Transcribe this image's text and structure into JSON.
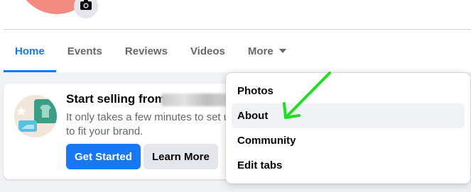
{
  "colors": {
    "accent": "#1877f2",
    "avatar": "#f28b82",
    "annotation_arrow": "#22dd22",
    "page_bg": "#f0f2f5"
  },
  "profile": {
    "avatar_icon": "avatar-image",
    "camera_icon": "camera-icon"
  },
  "tabs": [
    {
      "label": "Home",
      "active": true
    },
    {
      "label": "Events",
      "active": false
    },
    {
      "label": "Reviews",
      "active": false
    },
    {
      "label": "Videos",
      "active": false
    },
    {
      "label": "More",
      "active": false,
      "icon": "caret-down-icon"
    }
  ],
  "card": {
    "title": "Start selling from",
    "description_lines": [
      "It only takes a few minutes to set u",
      "to fit your brand."
    ],
    "primary_button": "Get Started",
    "secondary_button": "Learn More",
    "illustration_icon": "shop-illustration"
  },
  "more_menu": {
    "items": [
      {
        "label": "Photos",
        "highlighted": false
      },
      {
        "label": "About",
        "highlighted": true
      },
      {
        "label": "Community",
        "highlighted": false
      },
      {
        "label": "Edit tabs",
        "highlighted": false
      }
    ]
  },
  "annotation": {
    "icon": "green-arrow",
    "points_to": "About"
  }
}
